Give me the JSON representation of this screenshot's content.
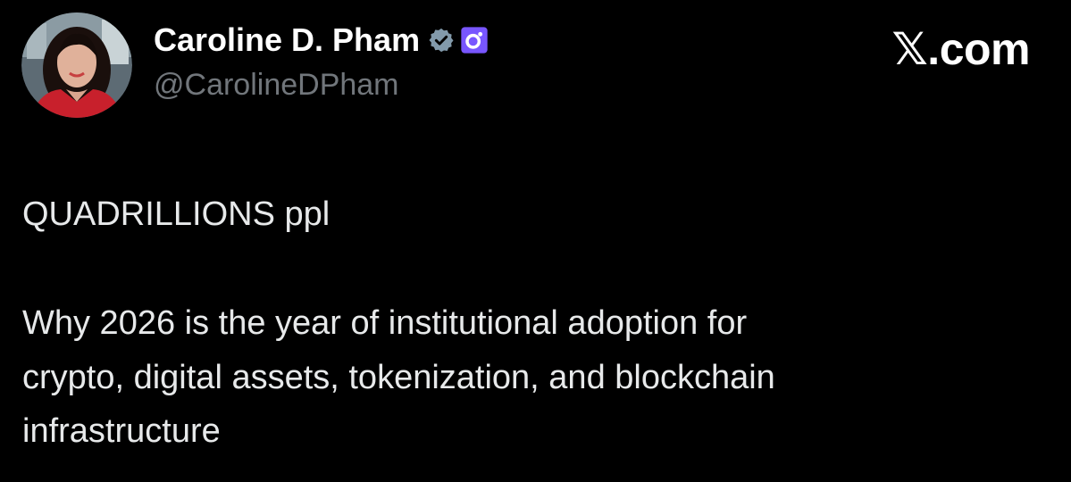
{
  "author": {
    "display_name": "Caroline D. Pham",
    "handle": "@CarolineDPham",
    "avatar_icon": "profile-photo",
    "verified_icon": "verified-badge-icon",
    "affiliation_icon": "affiliation-badge-icon"
  },
  "site": {
    "label": "𝕏.com"
  },
  "tweet": {
    "line1": "QUADRILLIONS ppl",
    "line2": "Why 2026 is the year of institutional adoption for",
    "line3": "crypto, digital assets, tokenization, and blockchain",
    "line4": "infrastructure"
  },
  "colors": {
    "background": "#000000",
    "name": "#ffffff",
    "handle": "#71767b",
    "body_text": "#e7e9ea",
    "verified": "#829aab",
    "affiliation": "#7856ff"
  }
}
